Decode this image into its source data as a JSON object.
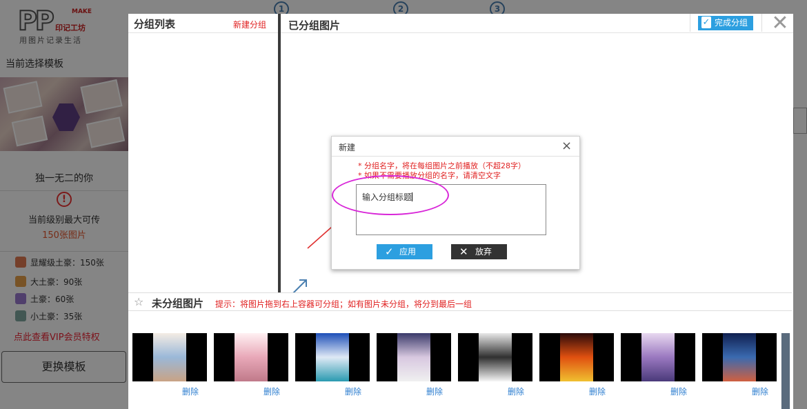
{
  "logo": {
    "main": "PP",
    "make": "MAKE",
    "brand": "印记工坊",
    "slogan": "用图片记录生活"
  },
  "steps": [
    "1",
    "2",
    "3"
  ],
  "left_panel": {
    "current_template_label": "当前选择模板",
    "template_name": "独一无二的你",
    "max_upload_label": "当前级别最大可传",
    "max_upload_value": "150张图片",
    "tiers": [
      {
        "label": "显耀级土豪：150张",
        "color": "#e07a52"
      },
      {
        "label": "大土豪：90张",
        "color": "#e6a04a"
      },
      {
        "label": "土豪：60张",
        "color": "#9a7ad0"
      },
      {
        "label": "小土豪：35张",
        "color": "#7fa8a0"
      }
    ],
    "vip_link": "点此查看VIP会员特权",
    "change_template_button": "更换模板"
  },
  "modal": {
    "group_list_title": "分组列表",
    "new_group_link": "新建分组",
    "grouped_title": "已分组图片",
    "done_button": "完成分组",
    "close_icon": "close-icon"
  },
  "ungrouped": {
    "title": "未分组图片",
    "tip": "提示：将图片拖到右上容器可分组；如有图片未分组，将分到最后一组",
    "delete_label": "删除",
    "photos": [
      {
        "delete": "删除",
        "colors": [
          "#f4ece4",
          "#9ab8d8",
          "#c9a385"
        ]
      },
      {
        "delete": "删除",
        "colors": [
          "#fff0f2",
          "#e8a8b8",
          "#c07a8a"
        ]
      },
      {
        "delete": "删除",
        "colors": [
          "#1e4fb8",
          "#dfe9f5",
          "#2a9ab0"
        ]
      },
      {
        "delete": "删除",
        "colors": [
          "#3a3a6a",
          "#d8c8e0",
          "#f0f0f0"
        ]
      },
      {
        "delete": "删除",
        "colors": [
          "#e8e8e8",
          "#303030",
          "#f6f6f6"
        ]
      },
      {
        "delete": "删除",
        "colors": [
          "#2a0a0a",
          "#e05010",
          "#f0c030"
        ]
      },
      {
        "delete": "删除",
        "colors": [
          "#e8d8f0",
          "#9a78c0",
          "#4a3a7a"
        ]
      },
      {
        "delete": "删除",
        "colors": [
          "#102050",
          "#3a6ab0",
          "#d06040"
        ]
      }
    ]
  },
  "dialog": {
    "title": "新建",
    "note_1": "* 分组名字，将在每组图片之前播放（不超28字）",
    "note_2": "* 如果不需要播放分组的名字，请清空文字",
    "input_value": "输入分组标题",
    "apply_button": "应用",
    "cancel_button": "放弃"
  },
  "colors": {
    "accent": "#2c9fe0",
    "warning": "#e02020",
    "highlight": "#d826d8"
  }
}
